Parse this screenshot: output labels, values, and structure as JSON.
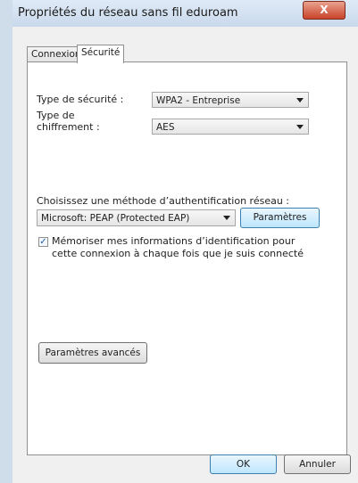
{
  "window": {
    "title": "Propriétés du réseau sans fil eduroam",
    "close_label": "X"
  },
  "tabs": [
    {
      "label": "Connexion"
    },
    {
      "label": "Sécurité"
    }
  ],
  "security": {
    "type_label": "Type de sécurité :",
    "type_value": "WPA2 - Entreprise",
    "encryption_label_line1": "Type de",
    "encryption_label_line2": "chiffrement :",
    "encryption_value": "AES"
  },
  "auth": {
    "method_label": "Choisissez une méthode d’authentification réseau :",
    "method_value": "Microsoft: PEAP (Protected EAP)",
    "settings_button": "Paramètres",
    "remember_checked": true,
    "remember_line1": "Mémoriser mes informations d’identification pour",
    "remember_line2": "cette connexion à chaque fois que je suis connecté"
  },
  "advanced_button": "Paramètres avancés",
  "footer": {
    "ok": "OK",
    "cancel": "Annuler"
  }
}
